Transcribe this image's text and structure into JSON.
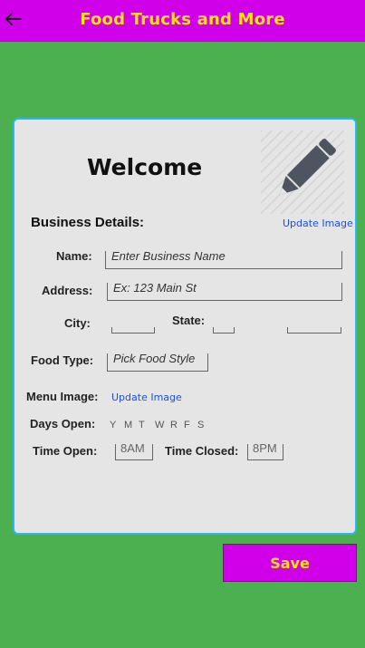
{
  "header": {
    "title": "Food Trucks and More",
    "back_icon": "arrow-left-icon",
    "color": "#d000e8",
    "title_color": "#ffe014"
  },
  "card": {
    "welcome": "Welcome",
    "image_icon": "pencil-icon",
    "update_image_label": "Update Image",
    "section_title": "Business Details:"
  },
  "form": {
    "name_label": "Name:",
    "name_placeholder": "Enter Business Name",
    "address_label": "Address:",
    "address_placeholder": "Ex: 123 Main St",
    "city_label": "City:",
    "state_label": "State:",
    "food_type_label": "Food Type:",
    "food_type_placeholder": "Pick Food Style",
    "menu_image_label": "Menu Image:",
    "menu_update_label": "Update Image",
    "days_open_label": "Days Open:",
    "days": [
      "Y",
      "M",
      "T",
      "W",
      "R",
      "F",
      "S"
    ],
    "time_open_label": "Time Open:",
    "time_open_value": "8AM",
    "time_closed_label": "Time Closed:",
    "time_closed_value": "8PM"
  },
  "actions": {
    "save_label": "Save"
  },
  "colors": {
    "background": "#4caf50",
    "card_border": "#29b6f6",
    "link": "#1e4fd8"
  }
}
